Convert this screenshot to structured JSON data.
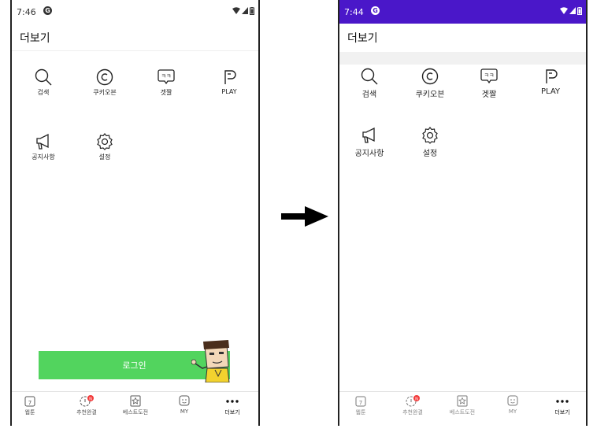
{
  "left_screen": {
    "status": {
      "time": "7:46",
      "app_indicator": "G"
    },
    "title": "더보기",
    "menu_items": [
      {
        "label": "검색",
        "icon": "search-icon"
      },
      {
        "label": "쿠키오븐",
        "icon": "cookie-oven-icon"
      },
      {
        "label": "겟짤",
        "icon": "speech-bubble-icon"
      },
      {
        "label": "PLAY",
        "icon": "play-icon"
      },
      {
        "label": "공지사항",
        "icon": "megaphone-icon"
      },
      {
        "label": "설정",
        "icon": "gear-icon"
      }
    ],
    "login_button": "로그인",
    "nav": [
      {
        "label": "웹툰",
        "icon": "calendar-7-icon"
      },
      {
        "label": "추천완결",
        "icon": "recommend-complete-icon",
        "badge": "N"
      },
      {
        "label": "베스트도전",
        "icon": "best-challenge-icon"
      },
      {
        "label": "MY",
        "icon": "my-face-icon"
      },
      {
        "label": "더보기",
        "icon": "more-dots-icon"
      }
    ]
  },
  "right_screen": {
    "status": {
      "time": "7:44",
      "app_indicator": "G"
    },
    "title": "더보기",
    "menu_items": [
      {
        "label": "검색",
        "icon": "search-icon"
      },
      {
        "label": "쿠키오븐",
        "icon": "cookie-oven-icon"
      },
      {
        "label": "겟짤",
        "icon": "speech-bubble-icon"
      },
      {
        "label": "PLAY",
        "icon": "play-icon"
      },
      {
        "label": "공지사항",
        "icon": "megaphone-icon"
      },
      {
        "label": "설정",
        "icon": "gear-icon"
      }
    ],
    "nav": [
      {
        "label": "웹툰",
        "icon": "calendar-7-icon"
      },
      {
        "label": "추천완결",
        "icon": "recommend-complete-icon",
        "badge": "N"
      },
      {
        "label": "베스트도전",
        "icon": "best-challenge-icon"
      },
      {
        "label": "MY",
        "icon": "my-face-icon"
      },
      {
        "label": "더보기",
        "icon": "more-dots-icon"
      }
    ]
  },
  "colors": {
    "login_green": "#52d45e",
    "status_purple": "#4a17c9",
    "badge_red": "#f23a3a"
  },
  "arrow_icon": "right-arrow-icon"
}
